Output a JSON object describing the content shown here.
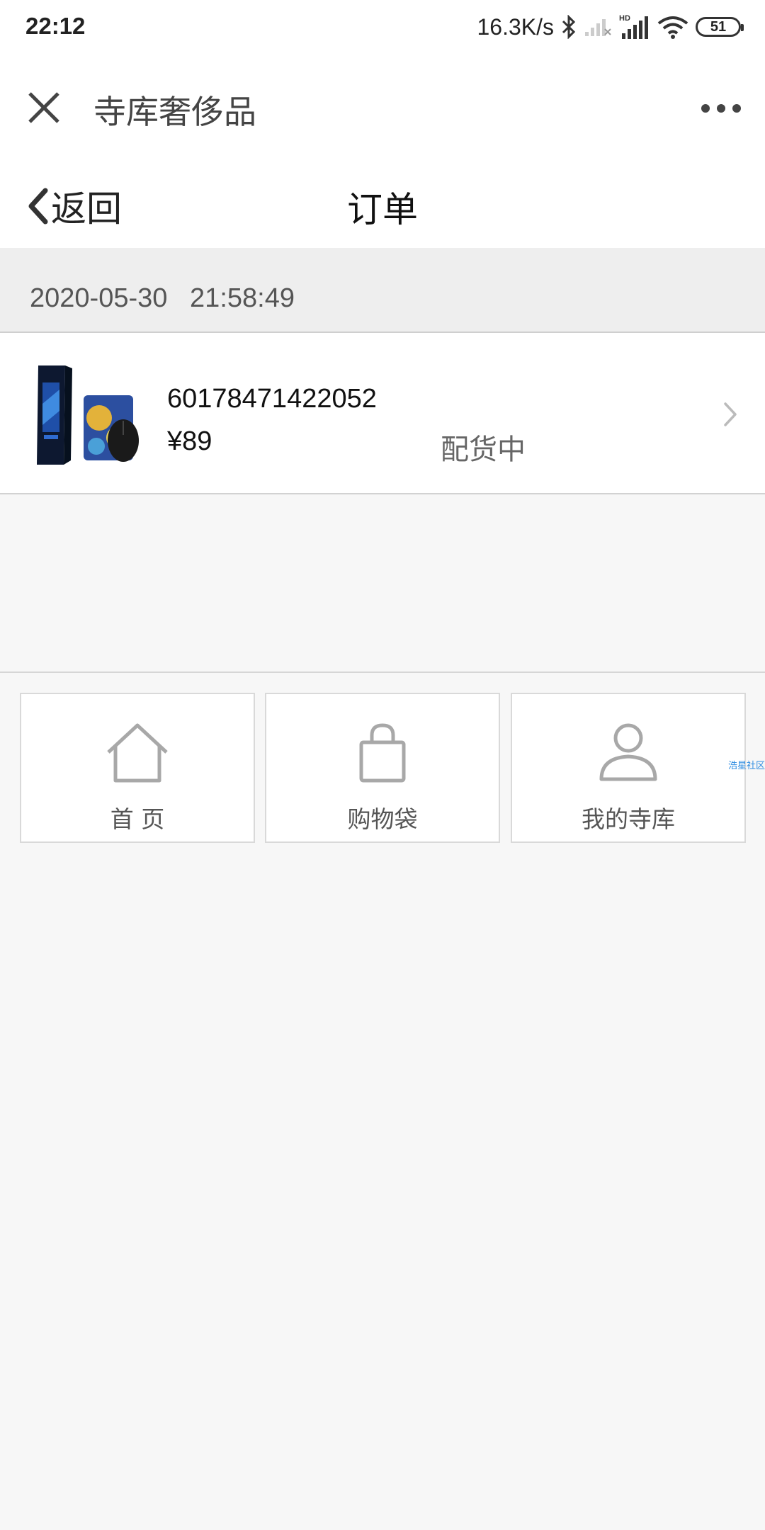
{
  "status_bar": {
    "time": "22:12",
    "network_speed": "16.3K/s",
    "battery_level": "51",
    "icons": [
      "bluetooth-icon",
      "signal-empty-icon",
      "hd-signal-icon",
      "wifi-icon",
      "battery-icon"
    ]
  },
  "wechat_bar": {
    "title": "寺库奢侈品",
    "close_icon": "close-icon",
    "more_icon": "more-dots-icon"
  },
  "header": {
    "back_label": "返回",
    "title": "订单"
  },
  "order": {
    "datetime": "2020-05-30   21:58:49",
    "number": "60178471422052",
    "price": "¥89",
    "status": "配货中"
  },
  "bottom_nav": {
    "items": [
      {
        "label": "首 页",
        "icon": "home-icon"
      },
      {
        "label": "购物袋",
        "icon": "shopping-bag-icon"
      },
      {
        "label": "我的寺库",
        "icon": "user-icon"
      }
    ]
  },
  "watermark": "浩星社区",
  "colors": {
    "background": "#f7f7f7",
    "header_bg": "#ffffff",
    "date_strip_bg": "#eeeeee",
    "icon_gray": "#a8a8a8",
    "watermark_blue": "#2a8ae0"
  }
}
